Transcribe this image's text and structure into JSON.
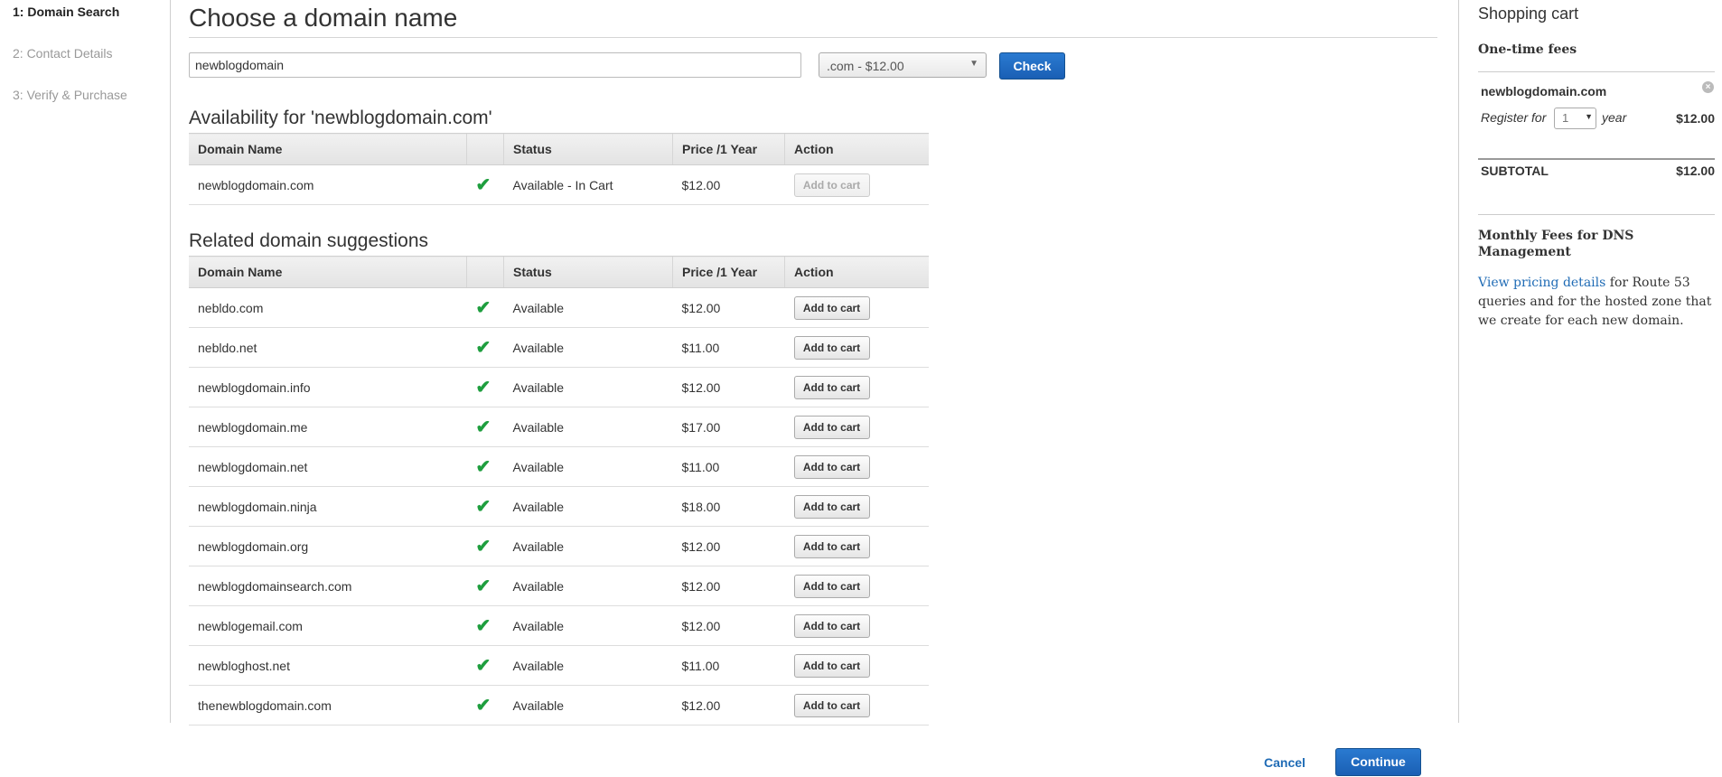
{
  "steps": [
    "1: Domain Search",
    "2: Contact Details",
    "3: Verify & Purchase"
  ],
  "main": {
    "title": "Choose a domain name",
    "search_value": "newblogdomain",
    "tld_selected": ".com - $12.00",
    "check_label": "Check"
  },
  "availability": {
    "title": "Availability for 'newblogdomain.com'",
    "headers": [
      "Domain Name",
      "",
      "Status",
      "Price /1 Year",
      "Action"
    ],
    "row": {
      "name": "newblogdomain.com",
      "status": "Available - In Cart",
      "price": "$12.00",
      "action": "Add to cart"
    }
  },
  "suggestions": {
    "title": "Related domain suggestions",
    "headers": [
      "Domain Name",
      "",
      "Status",
      "Price /1 Year",
      "Action"
    ],
    "rows": [
      {
        "name": "nebldo.com",
        "status": "Available",
        "price": "$12.00",
        "action": "Add to cart"
      },
      {
        "name": "nebldo.net",
        "status": "Available",
        "price": "$11.00",
        "action": "Add to cart"
      },
      {
        "name": "newblogdomain.info",
        "status": "Available",
        "price": "$12.00",
        "action": "Add to cart"
      },
      {
        "name": "newblogdomain.me",
        "status": "Available",
        "price": "$17.00",
        "action": "Add to cart"
      },
      {
        "name": "newblogdomain.net",
        "status": "Available",
        "price": "$11.00",
        "action": "Add to cart"
      },
      {
        "name": "newblogdomain.ninja",
        "status": "Available",
        "price": "$18.00",
        "action": "Add to cart"
      },
      {
        "name": "newblogdomain.org",
        "status": "Available",
        "price": "$12.00",
        "action": "Add to cart"
      },
      {
        "name": "newblogdomainsearch.com",
        "status": "Available",
        "price": "$12.00",
        "action": "Add to cart"
      },
      {
        "name": "newblogemail.com",
        "status": "Available",
        "price": "$12.00",
        "action": "Add to cart"
      },
      {
        "name": "newbloghost.net",
        "status": "Available",
        "price": "$11.00",
        "action": "Add to cart"
      },
      {
        "name": "thenewblogdomain.com",
        "status": "Available",
        "price": "$12.00",
        "action": "Add to cart"
      }
    ]
  },
  "cart": {
    "title": "Shopping cart",
    "one_time_fees": "One-time fees",
    "item_name": "newblogdomain.com",
    "register_for": "Register for",
    "years": "1",
    "year_word": "year",
    "item_price": "$12.00",
    "subtotal_label": "SUBTOTAL",
    "subtotal_value": "$12.00",
    "monthly_title": "Monthly Fees for DNS Management",
    "pricing_link": "View pricing details",
    "monthly_text": " for Route 53 queries and for the hosted zone that we create for each new domain."
  },
  "footer": {
    "cancel": "Cancel",
    "continue": "Continue"
  },
  "icons": {
    "available": "checkmark-icon",
    "remove": "close-circle-icon",
    "dropdown": "chevron-down-icon"
  },
  "colors": {
    "primary_button": "#1a5fb4",
    "check_green": "#1e9e3e",
    "link": "#1f6bb5"
  }
}
